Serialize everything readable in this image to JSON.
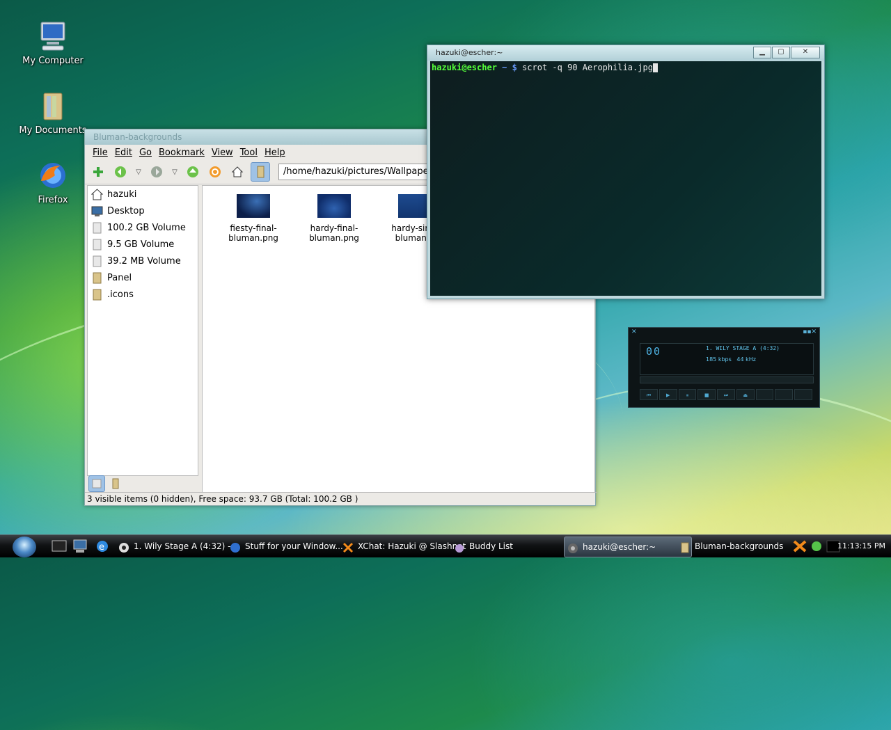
{
  "desktop": {
    "icons": [
      {
        "label": "My Computer"
      },
      {
        "label": "My Documents"
      },
      {
        "label": "Firefox"
      }
    ]
  },
  "file_manager": {
    "title": "Bluman-backgrounds",
    "menu": [
      "File",
      "Edit",
      "Go",
      "Bookmark",
      "View",
      "Tool",
      "Help"
    ],
    "address": "/home/hazuki/pictures/Wallpapers/Bluman-backgrounds",
    "sidebar": [
      "hazuki",
      "Desktop",
      "100.2 GB Volume",
      "9.5 GB Volume",
      "39.2 MB Volume",
      "Panel",
      ".icons"
    ],
    "files": [
      {
        "line1": "fiesty-final-",
        "line2": "bluman.png"
      },
      {
        "line1": "hardy-final-",
        "line2": "bluman.png"
      },
      {
        "line1": "hardy-simp",
        "line2": "bluman.p"
      }
    ],
    "status": "3 visible items (0 hidden), Free space: 93.7 GB (Total: 100.2 GB )"
  },
  "terminal": {
    "title": "hazuki@escher:~",
    "prompt_user": "hazuki@escher",
    "prompt_dir": "~ $",
    "command": "scrot -q 90 Aerophilia.jpg"
  },
  "player": {
    "time": "00",
    "track": "1. WILY STAGE A (4:32)",
    "bitrate": "185 kbps",
    "samplerate": "44 kHz"
  },
  "taskbar": {
    "tasks": [
      {
        "label": "1. Wily Stage A (4:32) - ..."
      },
      {
        "label": "Stuff for your Window..."
      },
      {
        "label": "XChat: Hazuki @ Slashnet"
      },
      {
        "label": "Buddy List"
      },
      {
        "label": "hazuki@escher:~"
      },
      {
        "label": "Bluman-backgrounds"
      }
    ],
    "clock": "11:13:15 PM"
  }
}
